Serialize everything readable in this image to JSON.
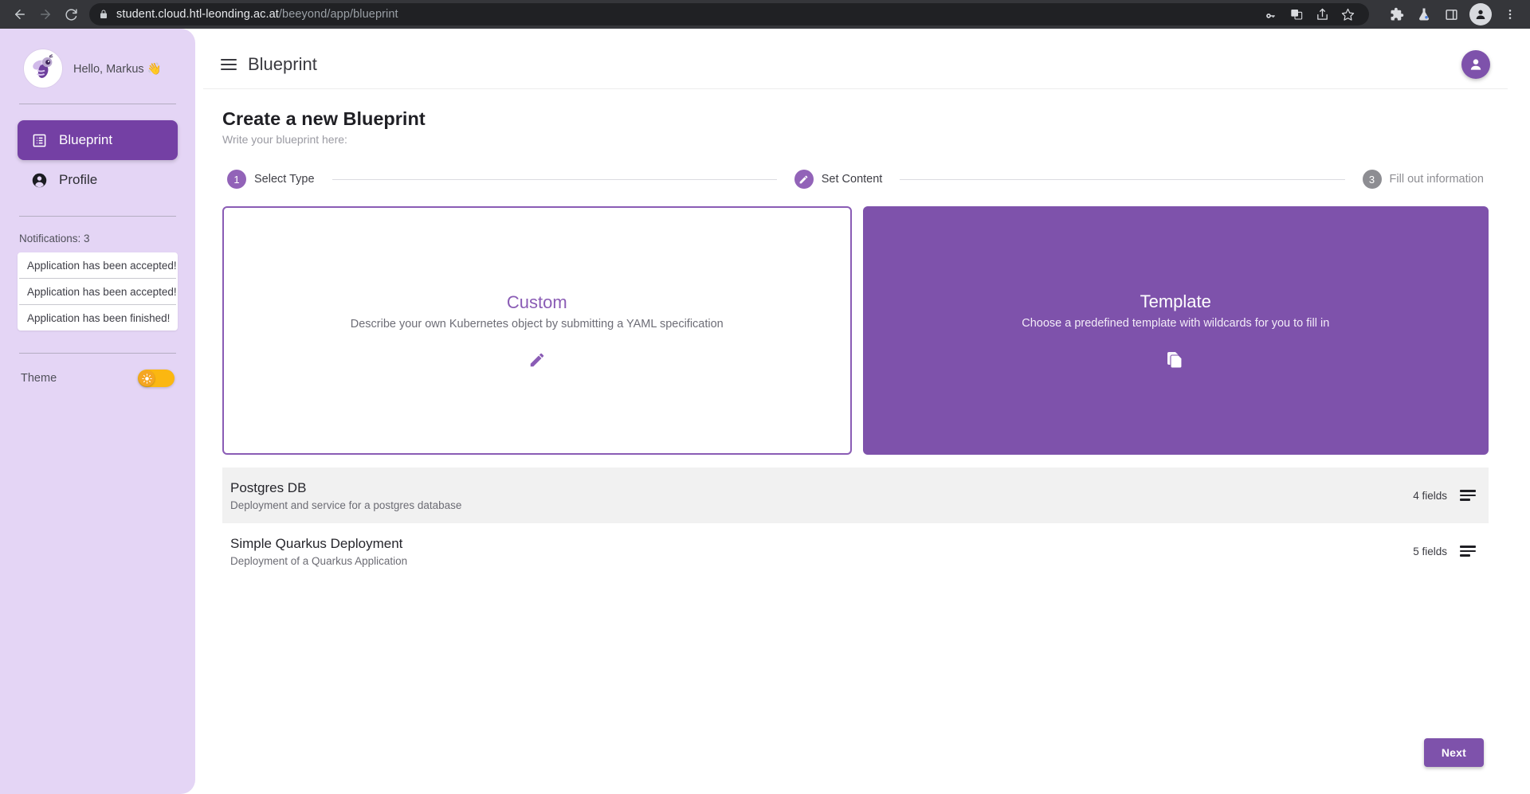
{
  "browser": {
    "url_host": "student.cloud.htl-leonding.ac.at",
    "url_path": "/beeyond/app/blueprint",
    "back_icon": "back-arrow-icon",
    "forward_icon": "forward-arrow-icon",
    "reload_icon": "reload-icon",
    "lock_icon": "lock-icon",
    "actions": [
      "password-key-icon",
      "translate-icon",
      "share-icon",
      "bookmark-star-icon"
    ],
    "extensions": [
      "puzzle-extensions-icon",
      "flask-labs-icon",
      "side-panel-icon"
    ],
    "profile_icon": "browser-profile-icon",
    "menu_icon": "three-dot-menu-icon"
  },
  "sidebar": {
    "greeting": "Hello, Markus 👋",
    "avatar_icon": "bee-avatar",
    "nav": [
      {
        "label": "Blueprint",
        "icon": "blueprint-list-icon",
        "active": true
      },
      {
        "label": "Profile",
        "icon": "person-icon",
        "active": false
      }
    ],
    "notifications_label": "Notifications: 3",
    "notifications": [
      "Application has been accepted!",
      "Application has been accepted!",
      "Application has been finished!"
    ],
    "theme_label": "Theme",
    "theme_toggle_icon": "sun-icon",
    "theme_toggle_on": true,
    "colors": {
      "bg": "#e4d5f5",
      "active_item": "#7440a4",
      "toggle": "#fbb711"
    }
  },
  "topbar": {
    "menu_icon": "hamburger-menu-icon",
    "title": "Blueprint",
    "avatar_icon": "user-avatar-icon",
    "avatar_color": "#7e52ab"
  },
  "page": {
    "title": "Create a new Blueprint",
    "subtitle": "Write your blueprint here:"
  },
  "stepper": {
    "steps": [
      {
        "marker": "1",
        "label": "Select Type",
        "state": "active"
      },
      {
        "marker": "edit-pencil-icon",
        "label": "Set Content",
        "state": "active"
      },
      {
        "marker": "3",
        "label": "Fill out information",
        "state": "inactive"
      }
    ]
  },
  "type_cards": [
    {
      "title": "Custom",
      "description": "Describe your own Kubernetes object by submitting a YAML specification",
      "icon": "pencil-icon",
      "selected": false
    },
    {
      "title": "Template",
      "description": "Choose a predefined template with wildcards for you to fill in",
      "icon": "copy-documents-icon",
      "selected": true
    }
  ],
  "templates": [
    {
      "name": "Postgres DB",
      "description": "Deployment and service for a postgres database",
      "fields": "4 fields",
      "icon": "fields-list-icon",
      "hovered": true
    },
    {
      "name": "Simple Quarkus Deployment",
      "description": "Deployment of a Quarkus Application",
      "fields": "5 fields",
      "icon": "fields-list-icon",
      "hovered": false
    }
  ],
  "footer": {
    "next_label": "Next"
  }
}
